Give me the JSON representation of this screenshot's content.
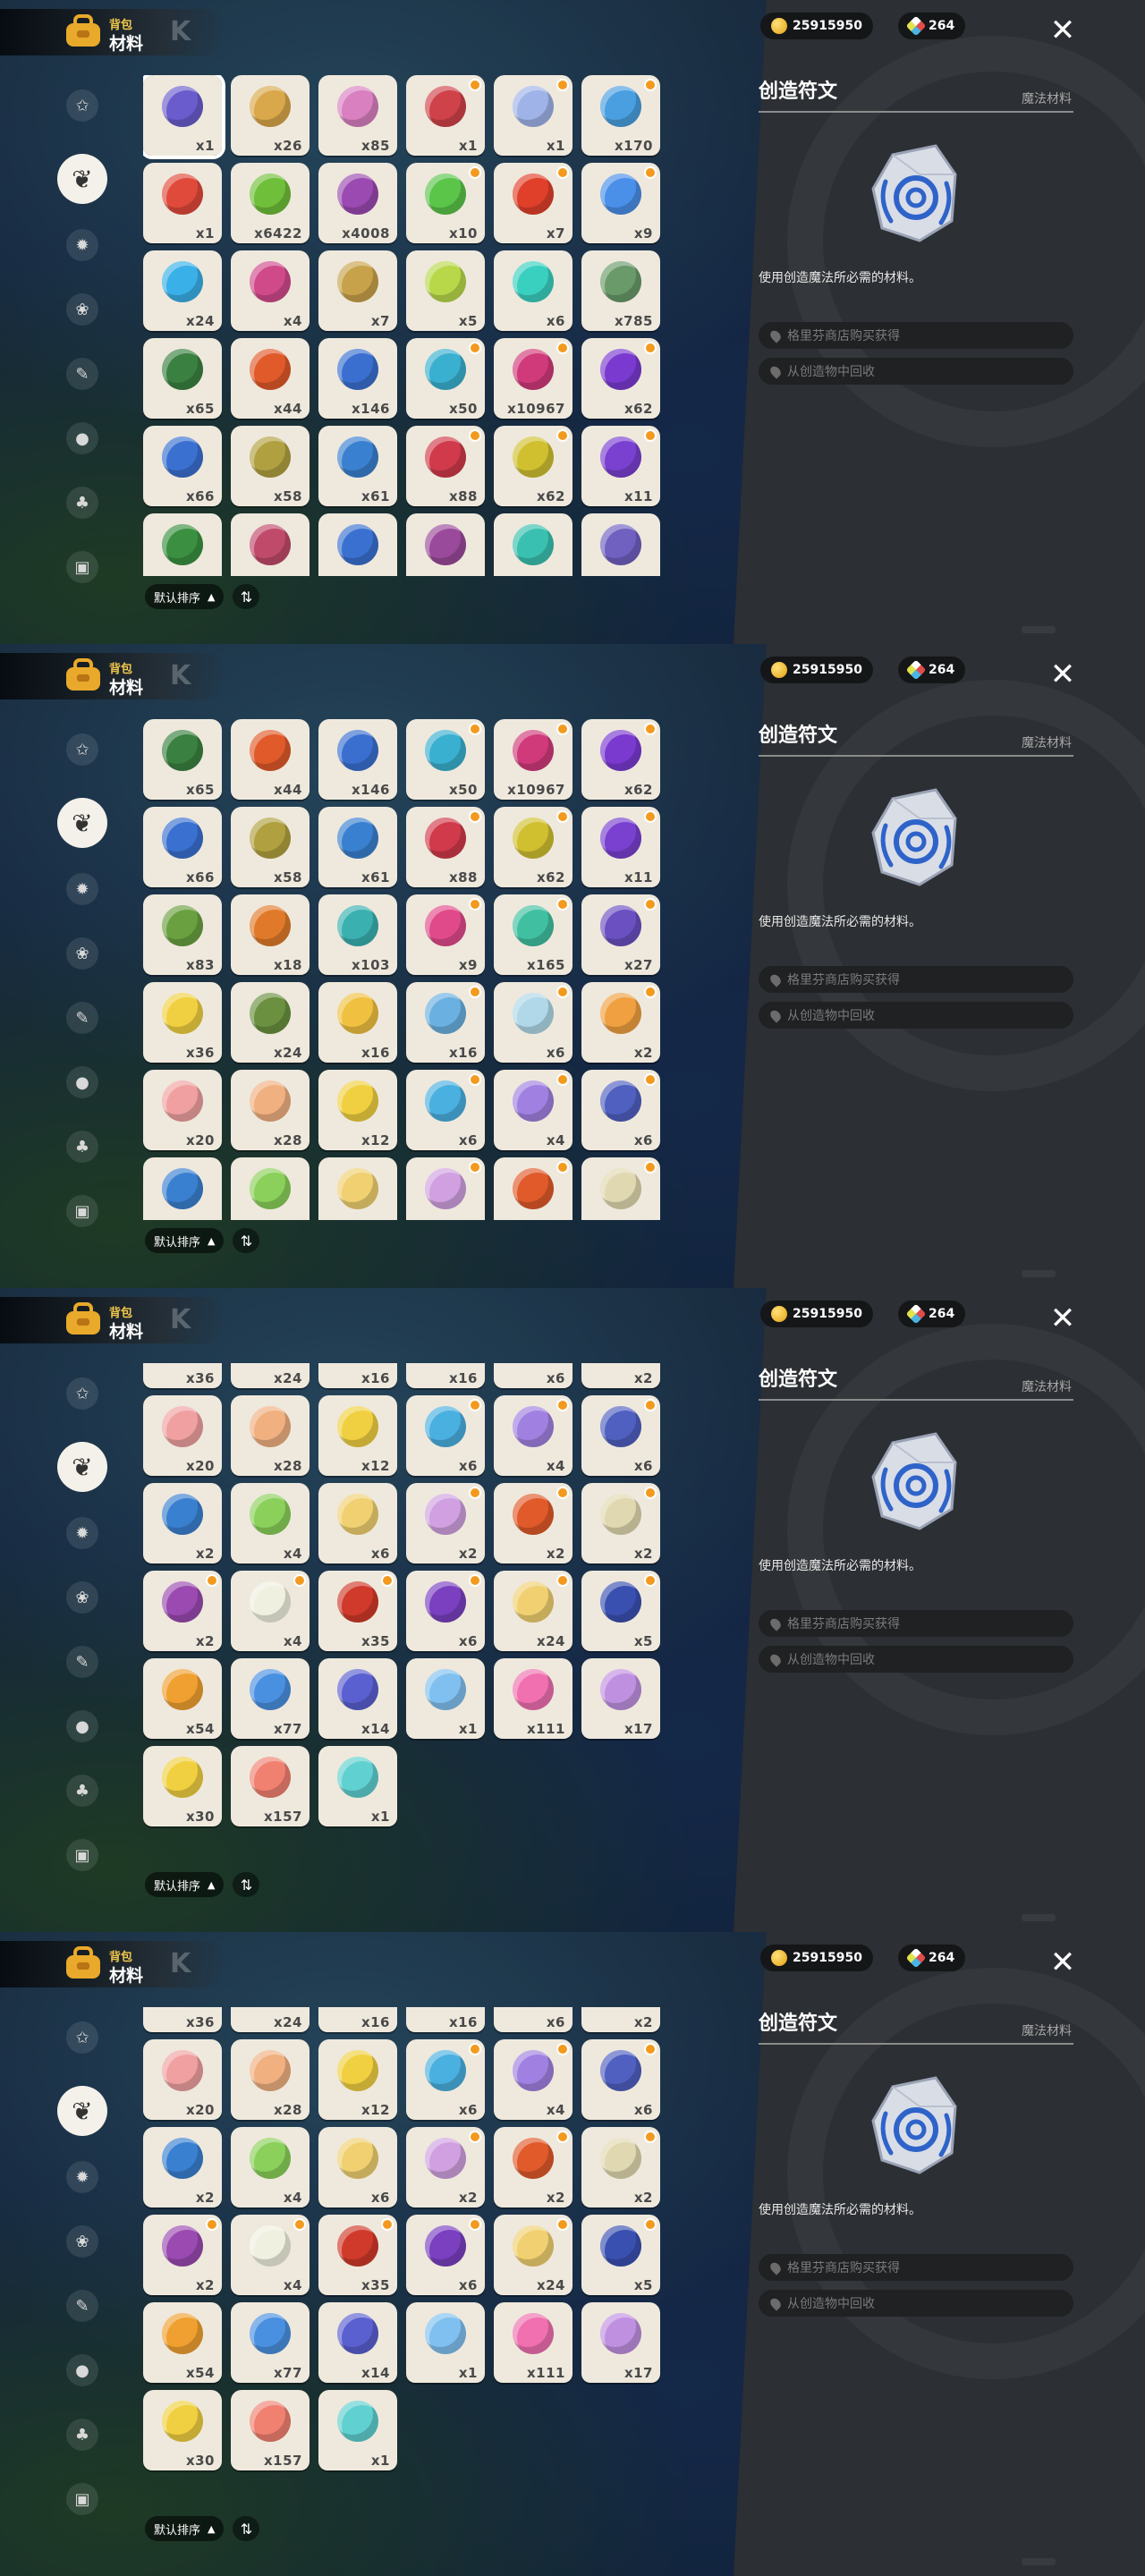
{
  "app": {
    "section_small": "背包",
    "section_big": "材料",
    "coins": "25915950",
    "gems": "264",
    "sort_label": "默认排序",
    "close_icon": "close-icon"
  },
  "sidebar": {
    "items": [
      {
        "icon": "star-icon"
      },
      {
        "icon": "leaf-icon",
        "active": true
      },
      {
        "icon": "gear-icon"
      },
      {
        "icon": "sprout-icon"
      },
      {
        "icon": "scroll-icon"
      },
      {
        "icon": "ball-icon"
      },
      {
        "icon": "acorn-icon"
      },
      {
        "icon": "chest-icon"
      }
    ]
  },
  "detail": {
    "title": "创造符文",
    "category": "魔法材料",
    "description": "使用创造魔法所必需的材料。",
    "sources": [
      "格里芬商店购买获得",
      "从创造物中回收"
    ],
    "item_icon": "rune-stone-icon"
  },
  "panels": [
    {
      "scroll_partial": true,
      "rows": [
        [
          [
            "#6b5ccd",
            "x1",
            false,
            true
          ],
          [
            "#d9a84a",
            "x26",
            false,
            false
          ],
          [
            "#d880c0",
            "x85",
            false,
            false
          ],
          [
            "#d0424a",
            "x1",
            true,
            false
          ],
          [
            "#9fb3e8",
            "x1",
            true,
            false
          ],
          [
            "#4a9fe0",
            "x170",
            true,
            false
          ]
        ],
        [
          [
            "#e04a3a",
            "x1",
            false,
            false
          ],
          [
            "#6fbf3a",
            "x6422",
            false,
            false
          ],
          [
            "#9a4ab0",
            "x4008",
            false,
            false
          ],
          [
            "#5bc54a",
            "x10",
            true,
            false
          ],
          [
            "#e0402a",
            "x7",
            true,
            false
          ],
          [
            "#4a8fe8",
            "x9",
            true,
            false
          ]
        ],
        [
          [
            "#3ab0e8",
            "x24",
            false,
            false
          ],
          [
            "#d04a8a",
            "x4",
            false,
            false
          ],
          [
            "#c8a24a",
            "x7",
            false,
            false
          ],
          [
            "#b8d84a",
            "x5",
            false,
            false
          ],
          [
            "#3ad0c0",
            "x6",
            false,
            false
          ],
          [
            "#6a9a6a",
            "x785",
            false,
            false
          ]
        ],
        [
          [
            "#3a8040",
            "x65",
            false,
            false
          ],
          [
            "#e05a2a",
            "x44",
            false,
            false
          ],
          [
            "#3a6fd0",
            "x146",
            false,
            false
          ],
          [
            "#3ab0d0",
            "x50",
            true,
            false
          ],
          [
            "#d03a7a",
            "x10967",
            true,
            false
          ],
          [
            "#7a3ad0",
            "x62",
            true,
            false
          ]
        ],
        [
          [
            "#3a70d0",
            "x66",
            false,
            false
          ],
          [
            "#b0a040",
            "x58",
            false,
            false
          ],
          [
            "#3a80d0",
            "x61",
            false,
            false
          ],
          [
            "#d03a4a",
            "x88",
            true,
            false
          ],
          [
            "#d0c030",
            "x62",
            true,
            false
          ],
          [
            "#7a40d0",
            "x11",
            true,
            false
          ]
        ],
        [
          [
            "#3a9040",
            "",
            false,
            false
          ],
          [
            "#c04a6a",
            "",
            false,
            false
          ],
          [
            "#3a70d0",
            "",
            false,
            false
          ],
          [
            "#9a4a9a",
            "",
            false,
            false
          ],
          [
            "#3ac0b0",
            "",
            false,
            false
          ],
          [
            "#7060c0",
            "",
            false,
            false
          ]
        ]
      ]
    },
    {
      "scroll_partial": false,
      "rows": [
        [
          [
            "#3a8040",
            "x65",
            false,
            false
          ],
          [
            "#e05a2a",
            "x44",
            false,
            false
          ],
          [
            "#3a6fd0",
            "x146",
            false,
            false
          ],
          [
            "#3ab0d0",
            "x50",
            true,
            false
          ],
          [
            "#d03a7a",
            "x10967",
            true,
            false
          ],
          [
            "#7a3ad0",
            "x62",
            true,
            false
          ]
        ],
        [
          [
            "#3a70d0",
            "x66",
            false,
            false
          ],
          [
            "#b0a040",
            "x58",
            false,
            false
          ],
          [
            "#3a80d0",
            "x61",
            false,
            false
          ],
          [
            "#d03a4a",
            "x88",
            true,
            false
          ],
          [
            "#d0c030",
            "x62",
            true,
            false
          ],
          [
            "#7a40d0",
            "x11",
            true,
            false
          ]
        ],
        [
          [
            "#6aa040",
            "x83",
            false,
            false
          ],
          [
            "#e07a2a",
            "x18",
            false,
            false
          ],
          [
            "#3ab0b0",
            "x103",
            false,
            false
          ],
          [
            "#e04a8a",
            "x9",
            true,
            false
          ],
          [
            "#40c0a0",
            "x165",
            true,
            false
          ],
          [
            "#6a50c0",
            "x27",
            true,
            false
          ]
        ],
        [
          [
            "#f0d040",
            "x36",
            false,
            false
          ],
          [
            "#6a9040",
            "x24",
            false,
            false
          ],
          [
            "#f0c040",
            "x16",
            false,
            false
          ],
          [
            "#6ab0e0",
            "x16",
            true,
            false
          ],
          [
            "#b0d8e8",
            "x6",
            true,
            false
          ],
          [
            "#f0a040",
            "x2",
            true,
            false
          ]
        ],
        [
          [
            "#f0a0a0",
            "x20",
            false,
            false
          ],
          [
            "#f0b080",
            "x28",
            false,
            false
          ],
          [
            "#f0d040",
            "x12",
            false,
            false
          ],
          [
            "#4ab0e0",
            "x6",
            true,
            false
          ],
          [
            "#a080e0",
            "x4",
            true,
            false
          ],
          [
            "#5060c0",
            "x6",
            true,
            false
          ]
        ],
        [
          [
            "#3a80d0",
            "x2",
            false,
            false
          ],
          [
            "#8ad05a",
            "x4",
            false,
            false
          ],
          [
            "#f0d070",
            "x6",
            false,
            false
          ],
          [
            "#d0a0e0",
            "x2",
            true,
            false
          ],
          [
            "#e05a2a",
            "x2",
            true,
            false
          ],
          [
            "#e0d8b0",
            "x2",
            true,
            false
          ]
        ]
      ]
    },
    {
      "scroll_partial": true,
      "rows": [
        [
          [
            "#f0d040",
            "x36",
            false,
            false
          ],
          [
            "#6a9040",
            "x24",
            false,
            false
          ],
          [
            "#f0c040",
            "x16",
            false,
            false
          ],
          [
            "#6ab0e0",
            "x16",
            false,
            false
          ],
          [
            "#b0d8e8",
            "x6",
            false,
            false
          ],
          [
            "#f0a040",
            "x2",
            false,
            false
          ]
        ],
        [
          [
            "#f0a0a0",
            "x20",
            false,
            false
          ],
          [
            "#f0b080",
            "x28",
            false,
            false
          ],
          [
            "#f0d040",
            "x12",
            false,
            false
          ],
          [
            "#4ab0e0",
            "x6",
            true,
            false
          ],
          [
            "#a080e0",
            "x4",
            true,
            false
          ],
          [
            "#5060c0",
            "x6",
            true,
            false
          ]
        ],
        [
          [
            "#3a80d0",
            "x2",
            false,
            false
          ],
          [
            "#8ad05a",
            "x4",
            false,
            false
          ],
          [
            "#f0d070",
            "x6",
            false,
            false
          ],
          [
            "#d0a0e0",
            "x2",
            true,
            false
          ],
          [
            "#e05a2a",
            "x2",
            true,
            false
          ],
          [
            "#e0d8b0",
            "x2",
            true,
            false
          ]
        ],
        [
          [
            "#9a4ab0",
            "x2",
            true,
            false
          ],
          [
            "#f0f0e0",
            "x4",
            true,
            false
          ],
          [
            "#d03a2a",
            "x35",
            true,
            false
          ],
          [
            "#7a40c0",
            "x6",
            true,
            false
          ],
          [
            "#f0d070",
            "x24",
            true,
            false
          ],
          [
            "#3a50b0",
            "x5",
            true,
            false
          ]
        ],
        [
          [
            "#f0a030",
            "x54",
            false,
            false
          ],
          [
            "#4a90e0",
            "x77",
            false,
            false
          ],
          [
            "#5a60d0",
            "x14",
            false,
            false
          ],
          [
            "#80c0f0",
            "x1",
            false,
            false
          ],
          [
            "#f070b0",
            "x111",
            false,
            false
          ],
          [
            "#c090e0",
            "x17",
            false,
            false
          ]
        ],
        [
          [
            "#f0d040",
            "x30",
            false,
            false
          ],
          [
            "#f08070",
            "x157",
            false,
            false
          ],
          [
            "#60d0d0",
            "x1",
            false,
            false
          ],
          null,
          null,
          null
        ]
      ]
    },
    {
      "scroll_partial": true,
      "rows": [
        [
          [
            "#f0d040",
            "x36",
            false,
            false
          ],
          [
            "#6a9040",
            "x24",
            false,
            false
          ],
          [
            "#f0c040",
            "x16",
            false,
            false
          ],
          [
            "#6ab0e0",
            "x16",
            false,
            false
          ],
          [
            "#b0d8e8",
            "x6",
            false,
            false
          ],
          [
            "#f0a040",
            "x2",
            false,
            false
          ]
        ],
        [
          [
            "#f0a0a0",
            "x20",
            false,
            false
          ],
          [
            "#f0b080",
            "x28",
            false,
            false
          ],
          [
            "#f0d040",
            "x12",
            false,
            false
          ],
          [
            "#4ab0e0",
            "x6",
            true,
            false
          ],
          [
            "#a080e0",
            "x4",
            true,
            false
          ],
          [
            "#5060c0",
            "x6",
            true,
            false
          ]
        ],
        [
          [
            "#3a80d0",
            "x2",
            false,
            false
          ],
          [
            "#8ad05a",
            "x4",
            false,
            false
          ],
          [
            "#f0d070",
            "x6",
            false,
            false
          ],
          [
            "#d0a0e0",
            "x2",
            true,
            false
          ],
          [
            "#e05a2a",
            "x2",
            true,
            false
          ],
          [
            "#e0d8b0",
            "x2",
            true,
            false
          ]
        ],
        [
          [
            "#9a4ab0",
            "x2",
            true,
            false
          ],
          [
            "#f0f0e0",
            "x4",
            true,
            false
          ],
          [
            "#d03a2a",
            "x35",
            true,
            false
          ],
          [
            "#7a40c0",
            "x6",
            true,
            false
          ],
          [
            "#f0d070",
            "x24",
            true,
            false
          ],
          [
            "#3a50b0",
            "x5",
            true,
            false
          ]
        ],
        [
          [
            "#f0a030",
            "x54",
            false,
            false
          ],
          [
            "#4a90e0",
            "x77",
            false,
            false
          ],
          [
            "#5a60d0",
            "x14",
            false,
            false
          ],
          [
            "#80c0f0",
            "x1",
            false,
            false
          ],
          [
            "#f070b0",
            "x111",
            false,
            false
          ],
          [
            "#c090e0",
            "x17",
            false,
            false
          ]
        ],
        [
          [
            "#f0d040",
            "x30",
            false,
            false
          ],
          [
            "#f08070",
            "x157",
            false,
            false
          ],
          [
            "#60d0d0",
            "x1",
            false,
            false
          ],
          null,
          null,
          null
        ]
      ]
    }
  ]
}
